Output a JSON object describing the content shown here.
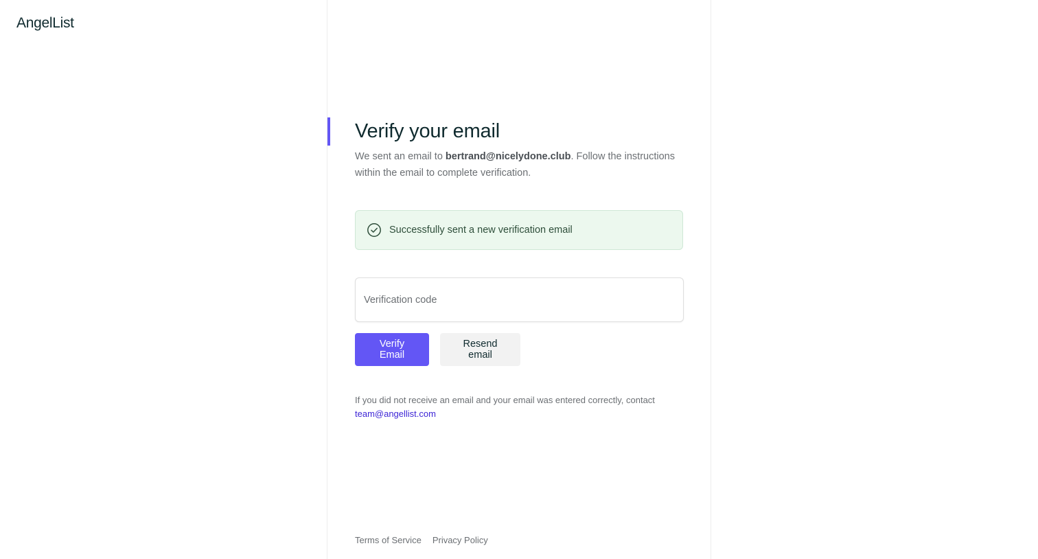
{
  "brand": {
    "logo_text": "AngelList",
    "accent_color": "#6356f5"
  },
  "verify": {
    "title": "Verify your email",
    "subtitle_prefix": "We sent an email to ",
    "email": "bertrand@nicelydone.club",
    "subtitle_suffix": ". Follow the instructions within the email to complete verification."
  },
  "alert": {
    "icon": "check-circle-icon",
    "message": "Successfully sent a new verification email",
    "bg_color": "#ecf8ee"
  },
  "form": {
    "code_placeholder": "Verification code",
    "code_value": "",
    "verify_label": "Verify Email",
    "resend_label": "Resend email"
  },
  "help": {
    "text": "If you did not receive an email and your email was entered correctly, contact",
    "contact_email": "team@angellist.com"
  },
  "footer": {
    "terms": "Terms of Service",
    "privacy": "Privacy Policy"
  }
}
